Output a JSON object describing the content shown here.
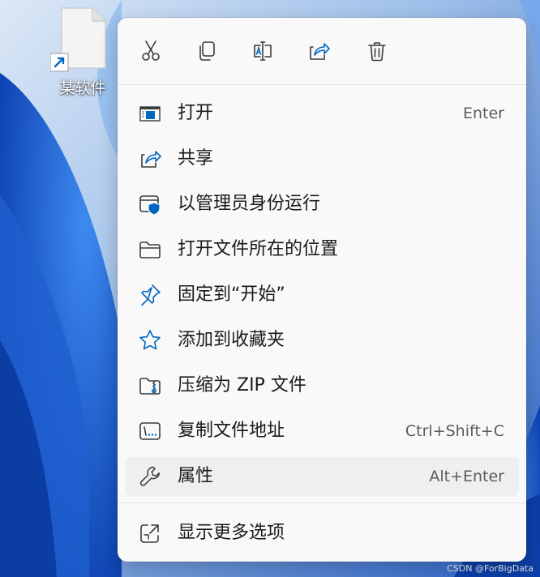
{
  "desktop": {
    "file_label": "某软件"
  },
  "colors": {
    "accent": "#0067c0",
    "icon_stroke": "#3a3a3a",
    "menu_bg": "#f9f9f9",
    "hover_bg": "#efefef"
  },
  "quick_actions": [
    {
      "name": "cut-icon"
    },
    {
      "name": "copy-icon"
    },
    {
      "name": "rename-icon"
    },
    {
      "name": "share-icon"
    },
    {
      "name": "delete-icon"
    }
  ],
  "menu": {
    "items": [
      {
        "label": "打开",
        "shortcut": "Enter",
        "icon": "open-app-icon"
      },
      {
        "label": "共享",
        "shortcut": "",
        "icon": "share-icon"
      },
      {
        "label": "以管理员身份运行",
        "shortcut": "",
        "icon": "run-as-admin-shield-icon"
      },
      {
        "label": "打开文件所在的位置",
        "shortcut": "",
        "icon": "folder-icon"
      },
      {
        "label": "固定到“开始”",
        "shortcut": "",
        "icon": "pin-icon"
      },
      {
        "label": "添加到收藏夹",
        "shortcut": "",
        "icon": "star-icon"
      },
      {
        "label": "压缩为 ZIP 文件",
        "shortcut": "",
        "icon": "zip-folder-icon"
      },
      {
        "label": "复制文件地址",
        "shortcut": "Ctrl+Shift+C",
        "icon": "copy-path-icon"
      },
      {
        "label": "属性",
        "shortcut": "Alt+Enter",
        "icon": "wrench-icon"
      },
      {
        "label": "显示更多选项",
        "shortcut": "",
        "icon": "show-more-options-icon"
      }
    ]
  },
  "watermark": "CSDN @ForBigData"
}
